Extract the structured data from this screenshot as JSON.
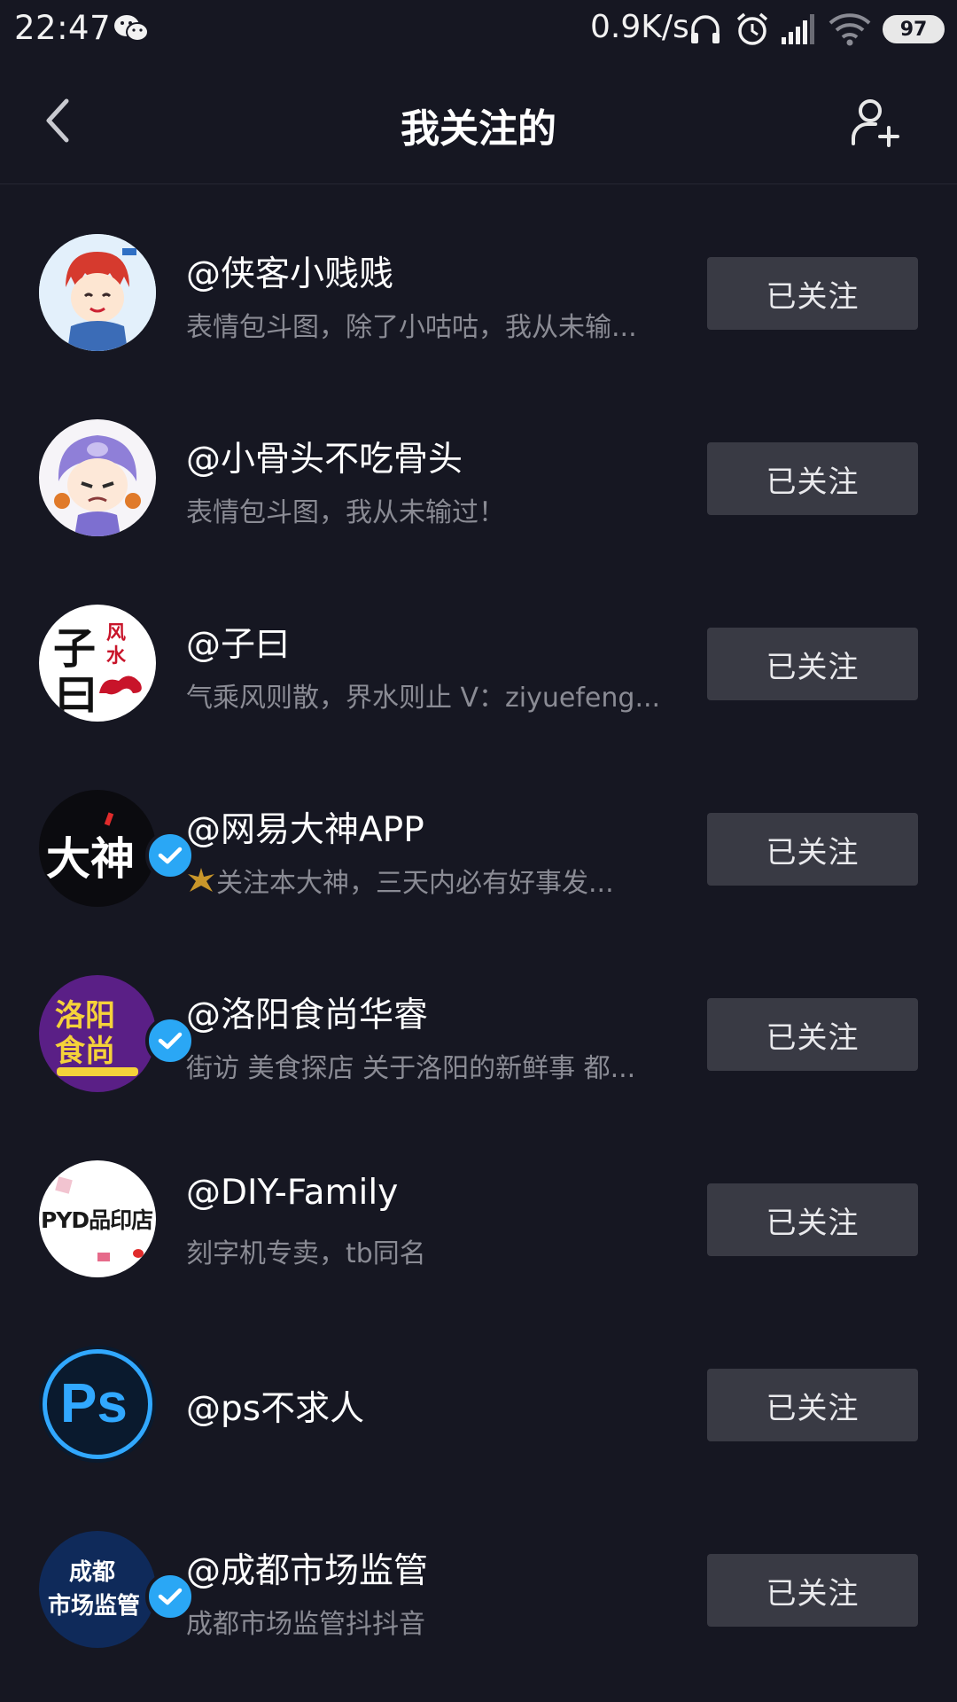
{
  "status_bar": {
    "time": "22:47",
    "net_speed": "0.9K/s",
    "battery": "97",
    "icons": [
      "wechat-icon",
      "headphone-icon",
      "alarm-icon",
      "signal-icon",
      "wifi-icon",
      "battery-icon"
    ]
  },
  "header": {
    "title": "我关注的",
    "back_icon": "chevron-left-icon",
    "add_icon": "add-user-icon"
  },
  "following": [
    {
      "name": "@侠客小贱贱",
      "bio": "表情包斗图，除了小咕咕，我从未输...",
      "verified": false,
      "button": "已关注"
    },
    {
      "name": "@小骨头不吃骨头",
      "bio": "表情包斗图，我从未输过！",
      "verified": false,
      "button": "已关注"
    },
    {
      "name": "@子曰",
      "bio": "气乘风则散，界水则止 V：ziyuefeng...",
      "verified": false,
      "button": "已关注",
      "avatar_text": [
        "子",
        "曰",
        "风",
        "水"
      ]
    },
    {
      "name": "@网易大神APP",
      "bio": "关注本大神，三天内必有好事发...",
      "verified": true,
      "button": "已关注",
      "avatar_text": [
        "大神"
      ]
    },
    {
      "name": "@洛阳食尚华睿",
      "bio": "街访 美食探店 关于洛阳的新鲜事 都...",
      "verified": true,
      "button": "已关注",
      "avatar_text": [
        "洛阳",
        "食尚"
      ]
    },
    {
      "name": "@DIY-Family",
      "bio": "刻字机专卖，tb同名",
      "verified": false,
      "button": "已关注",
      "avatar_text": [
        "PYD品印店"
      ]
    },
    {
      "name": "@ps不求人",
      "bio": "",
      "verified": false,
      "button": "已关注",
      "avatar_text": [
        "Ps"
      ]
    },
    {
      "name": "@成都市场监管",
      "bio": "成都市场监管抖抖音",
      "verified": true,
      "button": "已关注",
      "avatar_text": [
        "成都",
        "市场监管"
      ]
    }
  ],
  "colors": {
    "background": "#161722",
    "button_bg": "#393a44",
    "verified": "#2aa7f5",
    "bio_text": "#8a8b94"
  }
}
